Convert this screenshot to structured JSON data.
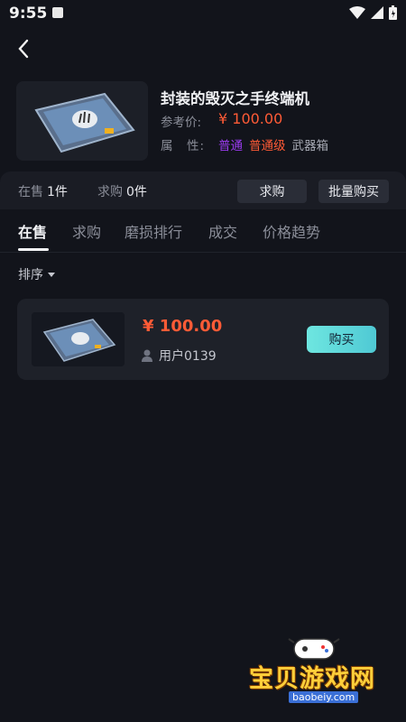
{
  "status": {
    "time": "9:55"
  },
  "product": {
    "title": "封装的毁灭之手终端机",
    "ref_label": "参考价:",
    "ref_price": "¥ 100.00",
    "attr_label": "属　性:",
    "tags": [
      "普通",
      "普通级",
      "武器箱"
    ]
  },
  "stats": {
    "on_sale_label": "在售",
    "on_sale_count": "1件",
    "wanted_label": "求购",
    "wanted_count": "0件",
    "want_button": "求购",
    "bulk_button": "批量购买"
  },
  "tabs": [
    "在售",
    "求购",
    "磨损排行",
    "成交",
    "价格趋势"
  ],
  "sort_label": "排序",
  "listing": {
    "price": "¥ 100.00",
    "user": "用户0139",
    "buy_label": "购买"
  },
  "watermark": {
    "title": "宝贝游戏网",
    "url": "baobeiy.com"
  },
  "colors": {
    "accent": "#ff5b36",
    "buy": "#5ed6da",
    "purple": "#9b3cf0",
    "bg": "#12141b"
  }
}
